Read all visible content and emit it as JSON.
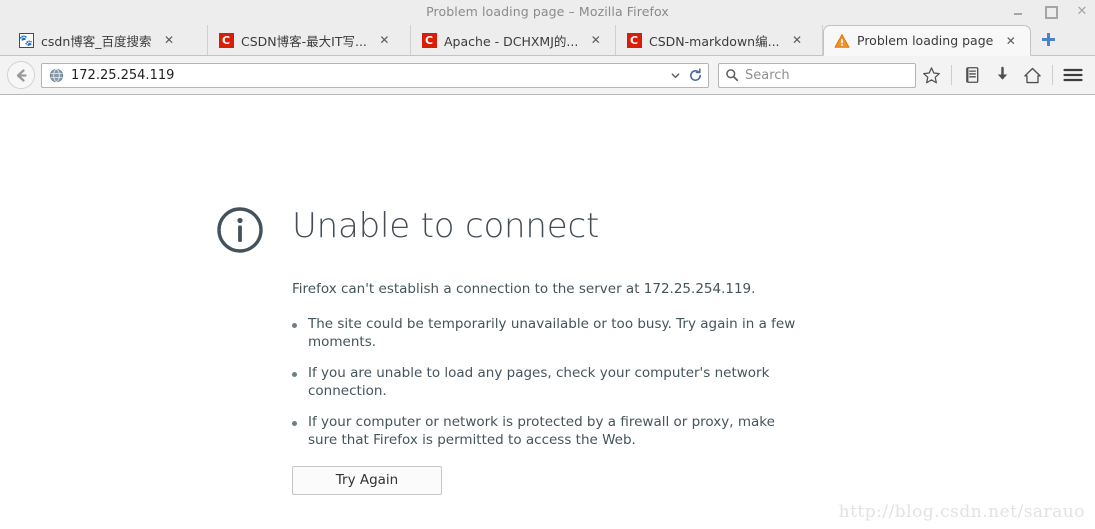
{
  "window": {
    "title": "Problem loading page – Mozilla Firefox",
    "controls": {
      "minimize": "–",
      "maximize": "□",
      "close": "✕"
    }
  },
  "tabs": [
    {
      "label": "csdn博客_百度搜索",
      "favicon": "baidu-paw-icon",
      "close": "✕",
      "active": false
    },
    {
      "label": "CSDN博客-最大IT写...",
      "favicon": "csdn-icon",
      "close": "✕",
      "active": false
    },
    {
      "label": "Apache - DCHXMJ的...",
      "favicon": "csdn-icon",
      "close": "✕",
      "active": false
    },
    {
      "label": "CSDN-markdown编...",
      "favicon": "csdn-icon",
      "close": "✕",
      "active": false
    },
    {
      "label": "Problem loading page",
      "favicon": "warning-triangle-icon",
      "close": "✕",
      "active": true
    }
  ],
  "newtab": {
    "tooltip": "+"
  },
  "toolbar": {
    "back": "back-arrow-icon",
    "url_value": "172.25.254.119",
    "url_icon": "globe-icon",
    "dropdown": "chevron-down-icon",
    "reload": "reload-icon",
    "search_placeholder": "Search",
    "search_value": "",
    "buttons": [
      {
        "name": "bookmark-star-icon"
      },
      {
        "name": "library-icon"
      },
      {
        "name": "downloads-icon"
      },
      {
        "name": "home-icon"
      },
      {
        "name": "menu-icon"
      }
    ]
  },
  "error_page": {
    "icon": "info-circle-icon",
    "title": "Unable to connect",
    "lead": "Firefox can't establish a connection to the server at 172.25.254.119.",
    "suggestions": [
      "The site could be temporarily unavailable or too busy. Try again in a few moments.",
      "If you are unable to load any pages, check your computer's network connection.",
      "If your computer or network is protected by a firewall or proxy, make sure that Firefox is permitted to access the Web."
    ],
    "retry_button": "Try Again"
  },
  "watermark": "http://blog.csdn.net/sarauo",
  "colors": {
    "chrome_bg": "#ededed",
    "toolbar_bg": "#f3f3f3",
    "text_dark": "#44545c",
    "accent_blue": "#4d82c4",
    "csdn_red": "#d81e06",
    "warning_orange": "#e8820c"
  }
}
